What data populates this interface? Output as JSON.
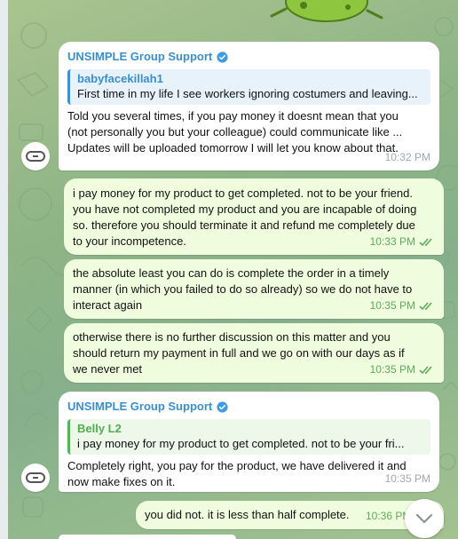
{
  "messages": [
    {
      "sender": "UNSIMPLE Group Support",
      "quote_author": "babyfacekillah1",
      "quote_text": "First time in my life I see workers ignoring costumers and leaving...",
      "lines": [
        "Told you several times, if you pay money it doesnt mean that you",
        "(not personally you but your colleague) could communicate like ...",
        "Updates will be uploaded tomorrow I will let you know about that."
      ],
      "time": "10:32 PM"
    },
    {
      "lines": [
        "i pay money for my product to get completed. not to be your friend.",
        "you have not completed my product and you are incapable of doing",
        "so. therefore you should terminate it and refund me completely due",
        "to your incompetence."
      ],
      "time": "10:33 PM"
    },
    {
      "lines": [
        "the absolute least you can do is complete the order in a timely",
        "manner (in which you failed to do so already) so we do not have to",
        "interact again"
      ],
      "time": "10:35 PM"
    },
    {
      "lines": [
        "otherwise there is no further discussion on this matter and you",
        "should return my payment in full and we go on with our days as if",
        "we never met"
      ],
      "time": "10:35 PM"
    },
    {
      "sender": "UNSIMPLE Group Support",
      "quote_author": "Belly L2",
      "quote_text": "i pay money for my product to get completed. not to be your fri...",
      "lines": [
        "Completely right, you pay for the product, we have delivered it and",
        "now make fixes on it."
      ],
      "time": "10:35 PM"
    },
    {
      "lines": [
        "you did not. it is less than half complete."
      ],
      "time": "10:36 PM"
    }
  ],
  "colors": {
    "incoming_bubble": "#ffffff",
    "outgoing_bubble": "#effdde",
    "sender_name": "#3a8fcb",
    "outgoing_time": "#5fa95b",
    "incoming_time": "#a0a8ae"
  },
  "icons": [
    "verified-badge-icon",
    "double-check-icon",
    "chevron-down-icon",
    "group-avatar-icon"
  ]
}
